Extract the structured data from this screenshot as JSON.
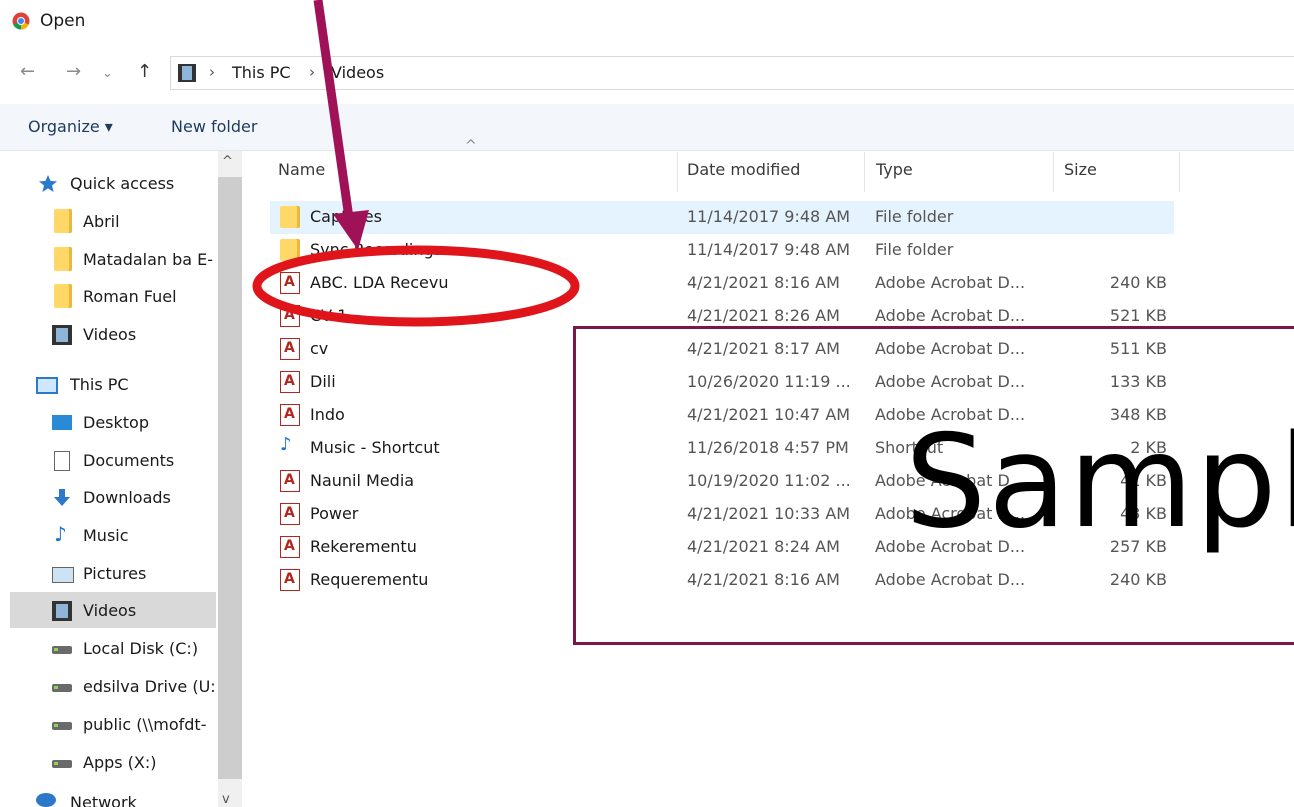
{
  "window": {
    "title": "Open"
  },
  "address": {
    "crumbs": [
      "This PC",
      "Videos"
    ]
  },
  "commands": {
    "organize": "Organize ▾",
    "new_folder": "New folder"
  },
  "sidebar": {
    "items": [
      {
        "label": "Quick access",
        "icon": "star-icon"
      },
      {
        "label": "Abril",
        "icon": "folder-icon"
      },
      {
        "label": "Matadalan ba E-",
        "icon": "folder-icon"
      },
      {
        "label": "Roman Fuel",
        "icon": "folder-icon"
      },
      {
        "label": "Videos",
        "icon": "video-icon"
      },
      {
        "label": "This PC",
        "icon": "computer-icon"
      },
      {
        "label": "Desktop",
        "icon": "desktop-icon"
      },
      {
        "label": "Documents",
        "icon": "document-icon"
      },
      {
        "label": "Downloads",
        "icon": "download-arrow-icon"
      },
      {
        "label": "Music",
        "icon": "music-note-icon"
      },
      {
        "label": "Pictures",
        "icon": "picture-icon"
      },
      {
        "label": "Videos",
        "icon": "video-icon"
      },
      {
        "label": "Local Disk (C:)",
        "icon": "local-disk-icon"
      },
      {
        "label": "edsilva Drive (U:)",
        "icon": "network-drive-icon"
      },
      {
        "label": "public (\\\\mofdt-",
        "icon": "network-drive-icon"
      },
      {
        "label": "Apps (X:)",
        "icon": "network-drive-icon"
      },
      {
        "label": "Network",
        "icon": "network-icon"
      }
    ]
  },
  "columns": {
    "name": "Name",
    "date": "Date modified",
    "type": "Type",
    "size": "Size"
  },
  "files": [
    {
      "name": "Captures",
      "date": "11/14/2017 9:48 AM",
      "type": "File folder",
      "size": "",
      "icon": "folder-icon"
    },
    {
      "name": "Sync Recordings",
      "date": "11/14/2017 9:48 AM",
      "type": "File folder",
      "size": "",
      "icon": "folder-icon"
    },
    {
      "name": "ABC. LDA Recevu",
      "date": "4/21/2021 8:16 AM",
      "type": "Adobe Acrobat D...",
      "size": "240 KB",
      "icon": "pdf-icon"
    },
    {
      "name": "CV 1",
      "date": "4/21/2021 8:26 AM",
      "type": "Adobe Acrobat D...",
      "size": "521 KB",
      "icon": "pdf-icon"
    },
    {
      "name": "cv",
      "date": "4/21/2021 8:17 AM",
      "type": "Adobe Acrobat D...",
      "size": "511 KB",
      "icon": "pdf-icon"
    },
    {
      "name": "Dili",
      "date": "10/26/2020 11:19 ...",
      "type": "Adobe Acrobat D...",
      "size": "133 KB",
      "icon": "pdf-icon"
    },
    {
      "name": "Indo",
      "date": "4/21/2021 10:47 AM",
      "type": "Adobe Acrobat D...",
      "size": "348 KB",
      "icon": "pdf-icon"
    },
    {
      "name": "Music - Shortcut",
      "date": "11/26/2018 4:57 PM",
      "type": "Shortcut",
      "size": "2 KB",
      "icon": "music-shortcut-icon"
    },
    {
      "name": "Naunil Media",
      "date": "10/19/2020 11:02 ...",
      "type": "Adobe Acrobat D...",
      "size": "41 KB",
      "icon": "pdf-icon"
    },
    {
      "name": "Power",
      "date": "4/21/2021 10:33 AM",
      "type": "Adobe Acrobat D...",
      "size": "43 KB",
      "icon": "pdf-icon"
    },
    {
      "name": "Rekerementu",
      "date": "4/21/2021 8:24 AM",
      "type": "Adobe Acrobat D...",
      "size": "257 KB",
      "icon": "pdf-icon"
    },
    {
      "name": "Requerementu",
      "date": "4/21/2021 8:16 AM",
      "type": "Adobe Acrobat D...",
      "size": "240 KB",
      "icon": "pdf-icon"
    }
  ],
  "overlay": {
    "sample_text": "Sampl"
  },
  "colors": {
    "arrow": "#a01257",
    "ellipse": "#e0151b",
    "sample_box": "#7b1648",
    "selection": "#e5f3ff"
  }
}
